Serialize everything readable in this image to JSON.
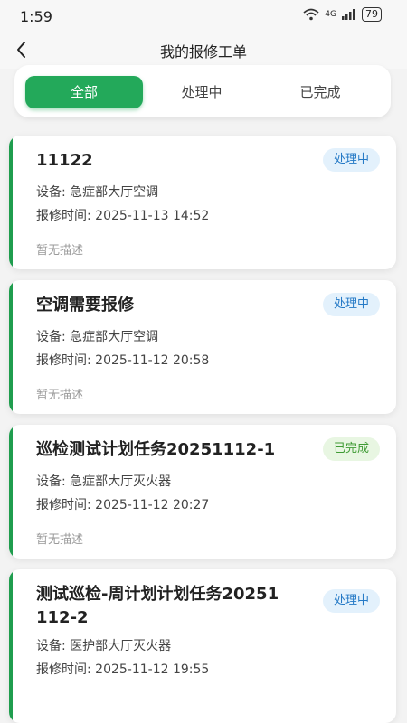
{
  "status_bar": {
    "time": "1:59",
    "network": "4G",
    "battery": "79"
  },
  "header": {
    "title": "我的报修工单"
  },
  "tabs": [
    {
      "label": "全部",
      "active": true
    },
    {
      "label": "处理中",
      "active": false
    },
    {
      "label": "已完成",
      "active": false
    }
  ],
  "orders": [
    {
      "title": "11122",
      "status": "处理中",
      "device": "设备: 急症部大厅空调",
      "time": "报修时间: 2025-11-13 14:52",
      "description": "暂无描述"
    },
    {
      "title": "空调需要报修",
      "status": "处理中",
      "device": "设备: 急症部大厅空调",
      "time": "报修时间: 2025-11-12 20:58",
      "description": "暂无描述"
    },
    {
      "title": "巡检测试计划任务20251112-1",
      "status": "已完成",
      "device": "设备: 急症部大厅灭火器",
      "time": "报修时间: 2025-11-12 20:27",
      "description": "暂无描述"
    },
    {
      "title_line1": "测试巡检-周计划计划任务20251",
      "title_line2": "112-2",
      "status": "处理中",
      "device": "设备: 医护部大厅灭火器",
      "time": "报修时间: 2025-11-12 19:55"
    }
  ],
  "colors": {
    "accent": "#23a95a",
    "processing_badge": "#e3f1fc",
    "done_badge": "#e8f6e2"
  }
}
